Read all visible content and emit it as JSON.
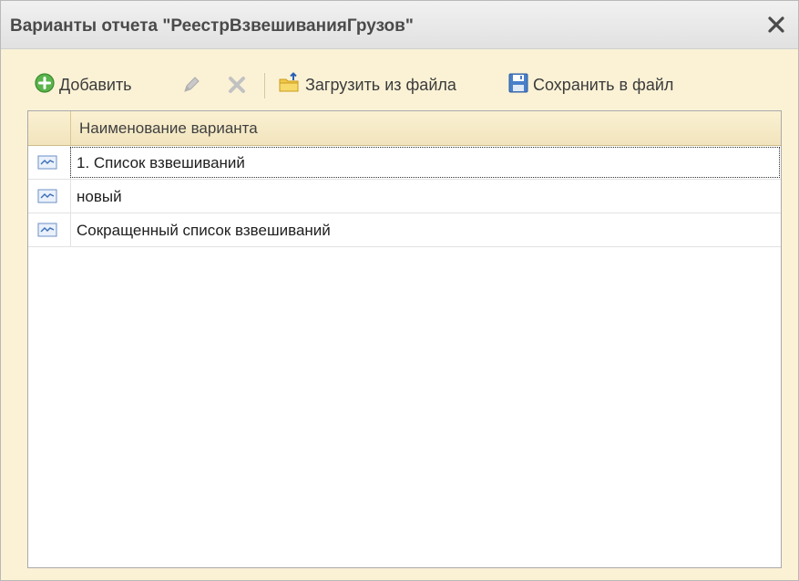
{
  "window": {
    "title": "Варианты отчета \"РеестрВзвешиванияГрузов\"",
    "close_icon": "close-icon"
  },
  "toolbar": {
    "add_label": "Добавить",
    "add_icon": "plus-circle-icon",
    "edit_icon": "pencil-icon",
    "delete_icon": "delete-x-icon",
    "load_label": "Загрузить из файла",
    "load_icon": "folder-upload-icon",
    "save_label": "Сохранить в файл",
    "save_icon": "floppy-disk-icon"
  },
  "grid": {
    "column_header": "Наименование варианта",
    "row_icon": "report-variant-icon",
    "rows": [
      {
        "name": "1. Список взвешиваний",
        "selected": true
      },
      {
        "name": "новый",
        "selected": false
      },
      {
        "name": "Сокращенный список взвешиваний",
        "selected": false
      }
    ]
  },
  "colors": {
    "panel_bg": "#fbf2d6",
    "header_bg": "#f1e4bd",
    "accent_green": "#48a83a"
  }
}
